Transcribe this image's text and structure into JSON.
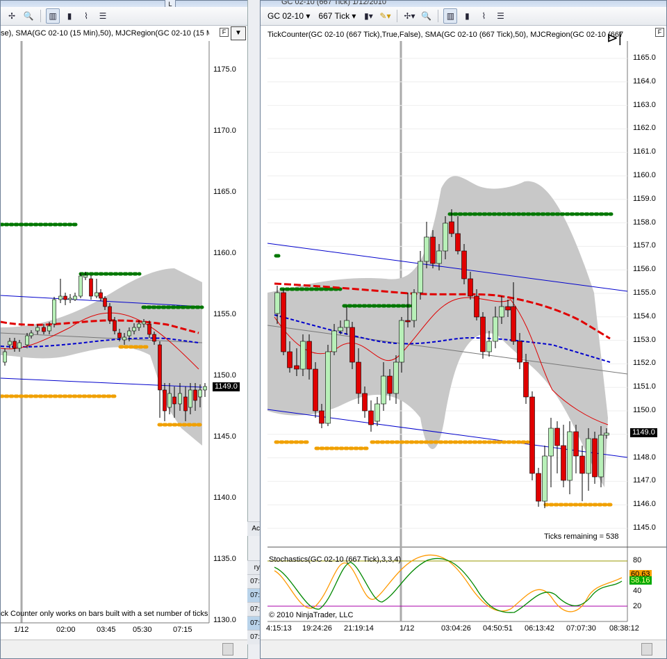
{
  "left_window": {
    "toolbar_buttons": [
      "crosshair-icon",
      "zoom-icon",
      "bar-chart-icon",
      "candlestick-icon",
      "line-chart-icon",
      "properties-icon"
    ],
    "corner_label": "L",
    "indicator_label": "se), SMA(GC 02-10 (15 Min),50), MJCRegion(GC 02-10 (15 M",
    "price_axis": [
      "1175.0",
      "1170.0",
      "1165.0",
      "1160.0",
      "1155.0",
      "1150.0",
      "1145.0",
      "1140.0",
      "1135.0",
      "1130.0"
    ],
    "time_axis": [
      "1/12",
      "02:00",
      "03:45",
      "05:30",
      "07:15"
    ],
    "current_price": "1149.0",
    "footer_note": "ck Counter only works on bars built with a set number of ticks",
    "colors": {
      "bull": "#b8f0b8",
      "bear": "#e00000",
      "sma": "#e00000",
      "region": "#c8c8c8",
      "trend": "#0000cc",
      "green_dots": "#007700",
      "orange_dots": "#f0a000"
    }
  },
  "middle_strip": {
    "items": [
      "Ac",
      "ry",
      "07:",
      "07:",
      "07:",
      "07:",
      "07:"
    ]
  },
  "right_window": {
    "title": "GC 02-10 (667 Tick)  1/12/2010",
    "instrument": "GC 02-10",
    "interval": "667 Tick",
    "toolbar_buttons": [
      "candlestick-icon",
      "pencil-icon",
      "crosshair-icon",
      "zoom-icon",
      "bar-chart-icon",
      "candlestick-icon",
      "line-chart-icon",
      "properties-icon"
    ],
    "indicator_label": "TickCounter(GC 02-10 (667 Tick),True,False), SMA(GC 02-10 (667 Tick),50), MJCRegion(GC 02-10 (667",
    "price_axis": [
      "1165.0",
      "1164.0",
      "1163.0",
      "1162.0",
      "1161.0",
      "1160.0",
      "1159.0",
      "1158.0",
      "1157.0",
      "1156.0",
      "1155.0",
      "1154.0",
      "1153.0",
      "1152.0",
      "1151.0",
      "1150.0",
      "1149.0",
      "1148.0",
      "1147.0",
      "1146.0",
      "1145.0"
    ],
    "current_price": "1149.0",
    "ticks_remaining": "Ticks remaining = 538",
    "stoch_label": "Stochastics(GC 02-10 (667 Tick),3,3,4)",
    "stoch_axis": [
      "80",
      "60",
      "40",
      "20"
    ],
    "stoch_values": {
      "k": "60.63",
      "d": "58.16"
    },
    "copyright": "© 2010 NinjaTrader, LLC",
    "time_axis": [
      "4:15:13",
      "19:24:26",
      "21:19:14",
      "1/12",
      "03:04:26",
      "04:50:51",
      "06:13:42",
      "07:07:30",
      "08:38:12"
    ],
    "colors": {
      "stoch_k": "#ff9900",
      "stoch_d": "#008800",
      "stoch_80": "#999900",
      "stoch_20": "#aa00aa",
      "bull": "#b8f0b8",
      "bear": "#e00000"
    }
  }
}
